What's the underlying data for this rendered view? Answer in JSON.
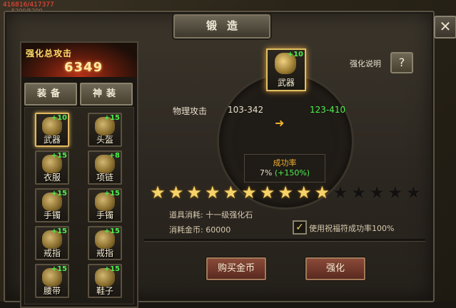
{
  "hud": {
    "hp": "416816/417377",
    "mp": "5200/5200"
  },
  "window": {
    "title": "锻造",
    "close_icon": "close-icon"
  },
  "left_panel": {
    "attack_label": "强化总攻击",
    "attack_value": "6349",
    "tabs": [
      {
        "label": "装备"
      },
      {
        "label": "神装"
      }
    ],
    "slots": [
      {
        "name": "武器",
        "level": "+10",
        "selected": true
      },
      {
        "name": "头盔",
        "level": "+15"
      },
      {
        "name": "衣服",
        "level": "+15"
      },
      {
        "name": "项链",
        "level": "+8"
      },
      {
        "name": "手镯",
        "level": "+15"
      },
      {
        "name": "手镯",
        "level": "+15"
      },
      {
        "name": "戒指",
        "level": "+15"
      },
      {
        "name": "戒指",
        "level": "+15"
      },
      {
        "name": "腰带",
        "level": "+15"
      },
      {
        "name": "鞋子",
        "level": "+15"
      }
    ]
  },
  "main": {
    "item": {
      "name": "武器",
      "level": "+10"
    },
    "help_label": "强化说明",
    "help_icon": "?",
    "stat": {
      "name": "物理攻击",
      "old": "103-342",
      "new": "123-410"
    },
    "success": {
      "label": "成功率",
      "value": "7%",
      "bonus": "(+150%)"
    },
    "stars": {
      "filled": 10,
      "total": 15
    },
    "material": "道具消耗: 十一级强化石",
    "gold": "消耗金币: 60000",
    "blessing": {
      "label": "使用祝福符成功率100%",
      "checked": true,
      "mark": "✓"
    },
    "buttons": {
      "buy": "购买金币",
      "forge": "强化"
    }
  },
  "colors": {
    "accent_green": "#4df04d",
    "gold": "#f6d36a",
    "button_red": "#8a4a38"
  }
}
